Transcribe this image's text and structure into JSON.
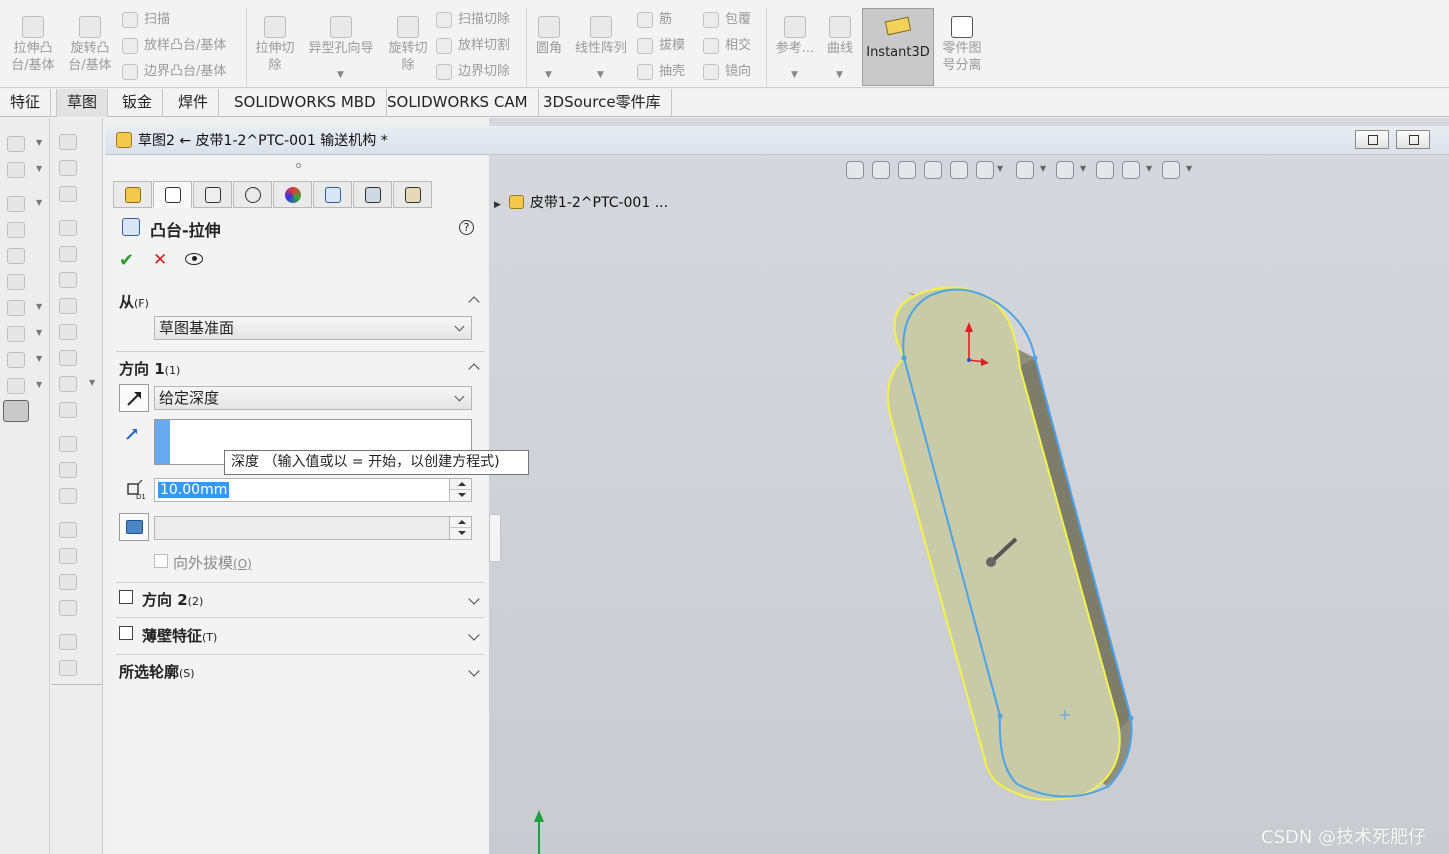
{
  "ribbon": {
    "big_buttons": [
      {
        "label_line1": "拉伸凸",
        "label_line2": "台/基体",
        "icon": "extruded-boss-icon"
      },
      {
        "label_line1": "旋转凸",
        "label_line2": "台/基体",
        "icon": "revolved-boss-icon"
      },
      {
        "label_line1": "拉伸切",
        "label_line2": "除",
        "icon": "extruded-cut-icon"
      },
      {
        "label_line1": "异型孔向导",
        "label_line2": "",
        "icon": "hole-wizard-icon"
      },
      {
        "label_line1": "旋转切",
        "label_line2": "除",
        "icon": "revolved-cut-icon"
      },
      {
        "label_line1": "圆角",
        "label_line2": "",
        "icon": "fillet-icon"
      },
      {
        "label_line1": "线性阵列",
        "label_line2": "",
        "icon": "linear-pattern-icon"
      },
      {
        "label_line1": "参考...",
        "label_line2": "",
        "icon": "reference-geometry-icon"
      },
      {
        "label_line1": "曲线",
        "label_line2": "",
        "icon": "curves-icon"
      }
    ],
    "small_buttons": [
      {
        "label": "扫描",
        "icon": "sweep-icon"
      },
      {
        "label": "放样凸台/基体",
        "icon": "loft-icon"
      },
      {
        "label": "边界凸台/基体",
        "icon": "boundary-boss-icon"
      },
      {
        "label": "扫描切除",
        "icon": "swept-cut-icon"
      },
      {
        "label": "放样切割",
        "icon": "lofted-cut-icon"
      },
      {
        "label": "边界切除",
        "icon": "boundary-cut-icon"
      },
      {
        "label": "筋",
        "icon": "rib-icon"
      },
      {
        "label": "拔模",
        "icon": "draft-icon"
      },
      {
        "label": "抽壳",
        "icon": "shell-icon"
      },
      {
        "label": "包覆",
        "icon": "wrap-icon"
      },
      {
        "label": "相交",
        "icon": "intersect-icon"
      },
      {
        "label": "镜向",
        "icon": "mirror-icon"
      }
    ],
    "instant3d": {
      "label": "Instant3D",
      "icon": "instant3d-icon"
    },
    "part_split": {
      "label_line1": "零件图",
      "label_line2": "号分离",
      "icon": "part-split-icon"
    }
  },
  "tabs": [
    {
      "label": "特征",
      "active": false
    },
    {
      "label": "草图",
      "active": true
    },
    {
      "label": "钣金",
      "active": false
    },
    {
      "label": "焊件",
      "active": false
    },
    {
      "label": "SOLIDWORKS MBD",
      "active": false
    },
    {
      "label": "SOLIDWORKS CAM",
      "active": false
    },
    {
      "label": "3DSource零件库",
      "active": false
    }
  ],
  "document": {
    "title": "草图2 ← 皮带1-2^PTC-001 输送机构 *",
    "tree_root": "皮带1-2^PTC-001 ..."
  },
  "property_manager": {
    "title": "凸台-拉伸",
    "from": {
      "header": "从",
      "hotkey": "(F)",
      "value": "草图基准面"
    },
    "direction1": {
      "header": "方向 1",
      "hotkey": "(1)",
      "end_condition": "给定深度",
      "depth_value": "10.00mm",
      "draft_outward_label": "向外拔模",
      "draft_outward_hotkey": "(O)"
    },
    "direction2": {
      "header": "方向 2",
      "hotkey": "(2)"
    },
    "thin_feature": {
      "header": "薄壁特征",
      "hotkey": "(T)"
    },
    "selected_contours": {
      "header": "所选轮廓",
      "hotkey": "(S)"
    },
    "tooltip": "深度 （输入值或以 = 开始，以创建方程式)"
  },
  "watermark": "CSDN @技术死肥仔",
  "colors": {
    "part_face": "#c7c9a8",
    "part_side": "#8f8e7c",
    "edge_yellow": "#f2f24a",
    "edge_blue": "#4da3e8",
    "accept": "#2e9e2e",
    "cancel": "#d42020"
  }
}
